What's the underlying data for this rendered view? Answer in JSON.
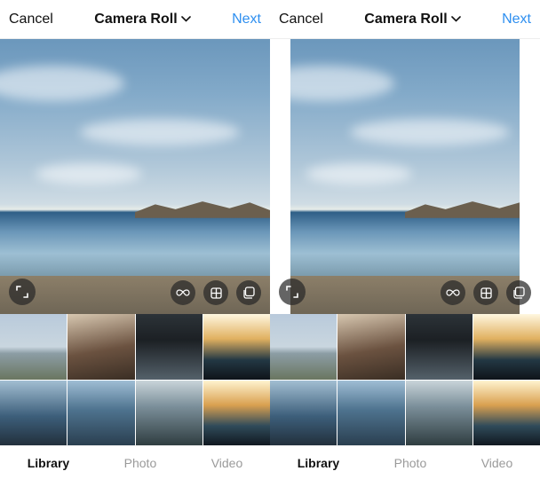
{
  "header": {
    "cancel": "Cancel",
    "title": "Camera Roll",
    "next": "Next"
  },
  "tabs": {
    "library": "Library",
    "photo": "Photo",
    "video": "Video",
    "selected": "library"
  },
  "overlay_icons": {
    "expand": "expand-icon",
    "boomerang": "infinity-icon",
    "layout": "layout-icon",
    "multi": "multi-select-icon"
  },
  "panes": [
    {
      "crop_mode": "full"
    },
    {
      "crop_mode": "fit"
    }
  ]
}
